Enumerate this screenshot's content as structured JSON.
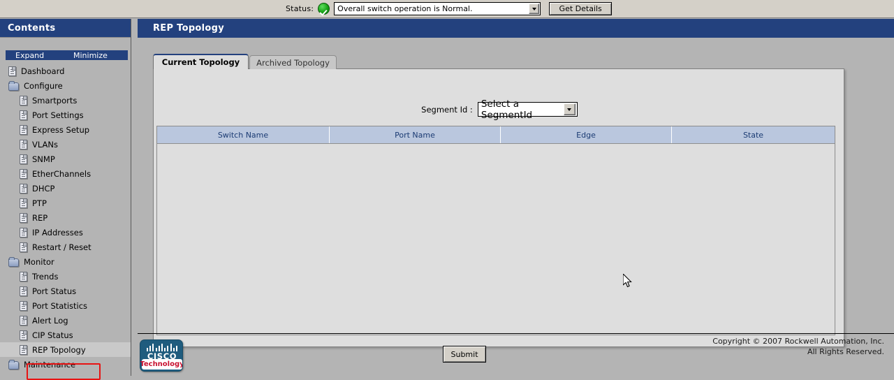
{
  "statusbar": {
    "label": "Status:",
    "icon": "green-check-icon",
    "selected_value": "Overall switch operation is Normal.",
    "get_details_label": "Get Details"
  },
  "sidebar": {
    "title": "Contents",
    "expand_label": "Expand",
    "minimize_label": "Minimize",
    "items": [
      {
        "label": "Dashboard",
        "icon": "file-icon",
        "level": 0,
        "selected": false
      },
      {
        "label": "Configure",
        "icon": "folder-icon",
        "level": 0,
        "selected": false
      },
      {
        "label": "Smartports",
        "icon": "file-icon",
        "level": 1,
        "selected": false
      },
      {
        "label": "Port Settings",
        "icon": "file-icon",
        "level": 1,
        "selected": false
      },
      {
        "label": "Express Setup",
        "icon": "file-icon",
        "level": 1,
        "selected": false
      },
      {
        "label": "VLANs",
        "icon": "file-icon",
        "level": 1,
        "selected": false
      },
      {
        "label": "SNMP",
        "icon": "file-icon",
        "level": 1,
        "selected": false
      },
      {
        "label": "EtherChannels",
        "icon": "file-icon",
        "level": 1,
        "selected": false
      },
      {
        "label": "DHCP",
        "icon": "file-icon",
        "level": 1,
        "selected": false
      },
      {
        "label": "PTP",
        "icon": "file-icon",
        "level": 1,
        "selected": false
      },
      {
        "label": "REP",
        "icon": "file-icon",
        "level": 1,
        "selected": false
      },
      {
        "label": "IP Addresses",
        "icon": "file-icon",
        "level": 1,
        "selected": false
      },
      {
        "label": "Restart / Reset",
        "icon": "file-icon",
        "level": 1,
        "selected": false
      },
      {
        "label": "Monitor",
        "icon": "folder-icon",
        "level": 0,
        "selected": false
      },
      {
        "label": "Trends",
        "icon": "file-icon",
        "level": 1,
        "selected": false
      },
      {
        "label": "Port Status",
        "icon": "file-icon",
        "level": 1,
        "selected": false
      },
      {
        "label": "Port Statistics",
        "icon": "file-icon",
        "level": 1,
        "selected": false
      },
      {
        "label": "Alert Log",
        "icon": "file-icon",
        "level": 1,
        "selected": false
      },
      {
        "label": "CIP Status",
        "icon": "file-icon",
        "level": 1,
        "selected": false
      },
      {
        "label": "REP Topology",
        "icon": "file-icon",
        "level": 1,
        "selected": true
      },
      {
        "label": "Maintenance",
        "icon": "folder-icon",
        "level": 0,
        "selected": false
      }
    ]
  },
  "main": {
    "title": "REP Topology",
    "tabs": [
      {
        "label": "Current Topology",
        "active": true
      },
      {
        "label": "Archived Topology",
        "active": false
      }
    ],
    "segment": {
      "label": "Segment Id :",
      "selected_value": "Select a SegmentId"
    },
    "table": {
      "columns": [
        "Switch Name",
        "Port Name",
        "Edge",
        "State"
      ],
      "rows": []
    }
  },
  "footer": {
    "cisco_word": "CISCO",
    "cisco_tech": "Technology",
    "submit_label": "Submit",
    "copyright_line1": "Copyright © 2007 Rockwell Automation, Inc.",
    "copyright_line2": "All Rights Reserved."
  },
  "colors": {
    "header_blue": "#23417e",
    "panel_gray": "#b4b4b4",
    "content_gray": "#dedede",
    "table_header_blue": "#bac7de",
    "highlight_red": "#e81313",
    "status_green": "#16a116",
    "cisco_blue": "#1f5c7e",
    "cisco_red": "#c8102e"
  }
}
